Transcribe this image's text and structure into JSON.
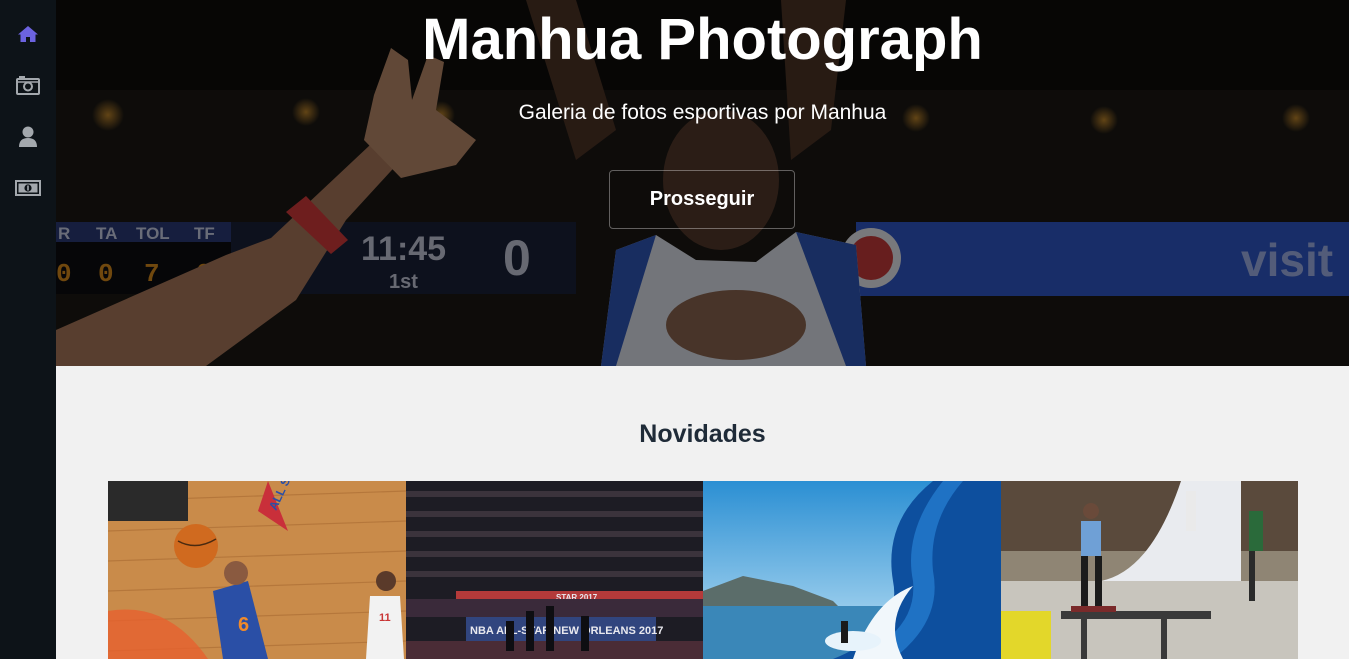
{
  "sidebar": {
    "items": [
      {
        "icon": "home-icon",
        "active": true
      },
      {
        "icon": "camera-icon",
        "active": false
      },
      {
        "icon": "user-icon",
        "active": false
      },
      {
        "icon": "money-icon",
        "active": false
      }
    ],
    "active_color": "#6c63e0",
    "inactive_color": "#a3a8ad"
  },
  "hero": {
    "title": "Manhua Photograph",
    "subtitle": "Galeria de fotos esportivas por Manhua",
    "button_label": "Prosseguir",
    "scoreboard": {
      "headers": [
        "R",
        "TA",
        "TOL",
        "TF"
      ],
      "values": [
        "0",
        "0",
        "7",
        "0"
      ],
      "clock": "11:45",
      "period": "1st",
      "score": "0"
    },
    "banner_text": "visit l"
  },
  "news": {
    "title": "Novidades",
    "photos": [
      {
        "alt": "Jogador de basquete enterrando no All-Star",
        "jersey": "6",
        "opponent_jersey": "11",
        "court_text": "ALL STAR"
      },
      {
        "alt": "Arena lotada no NBA All-Star New Orleans 2017",
        "banner": "NBA ALL-STAR NEW ORLEANS 2017",
        "top_banner": "STAR 2017"
      },
      {
        "alt": "Surfista em uma onda"
      },
      {
        "alt": "Skatista deslizando em um corrimão"
      }
    ]
  }
}
